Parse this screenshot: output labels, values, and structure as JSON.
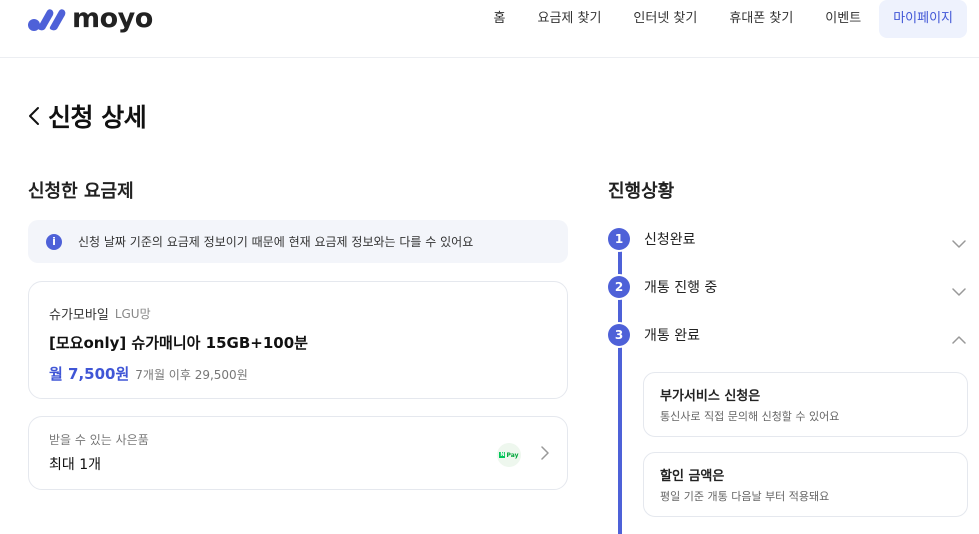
{
  "header": {
    "logo_text": "moyo",
    "nav": [
      {
        "label": "홈",
        "active": false
      },
      {
        "label": "요금제 찾기",
        "active": false
      },
      {
        "label": "인터넷 찾기",
        "active": false
      },
      {
        "label": "휴대폰 찾기",
        "active": false
      },
      {
        "label": "이벤트",
        "active": false
      },
      {
        "label": "마이페이지",
        "active": true
      }
    ]
  },
  "page": {
    "title": "신청 상세"
  },
  "plan_section": {
    "title": "신청한 요금제",
    "notice": "신청 날짜 기준의 요금제 정보이기 때문에 현재 요금제 정보와는 다를 수 있어요",
    "provider": "슈가모바일",
    "network": "LGU망",
    "plan_name": "[모요only] 슈가매니아 15GB+100분",
    "price": "월 7,500원",
    "price_after": "7개월 이후 29,500원"
  },
  "gift": {
    "label": "받을 수 있는 사은품",
    "value": "최대 1개",
    "badge": "Pay"
  },
  "progress": {
    "title": "진행상황",
    "steps": [
      {
        "num": "1",
        "label": "신청완료",
        "expanded": false
      },
      {
        "num": "2",
        "label": "개통 진행 중",
        "expanded": false
      },
      {
        "num": "3",
        "label": "개통 완료",
        "expanded": true
      }
    ],
    "details": [
      {
        "title": "부가서비스 신청은",
        "desc": "통신사로 직접 문의해 신청할 수 있어요"
      },
      {
        "title": "할인 금액은",
        "desc": "평일 기준 개통 다음날 부터 적용돼요"
      }
    ]
  },
  "colors": {
    "accent": "#4e61d8",
    "accent_text": "#4056d6",
    "notice_bg": "#f3f5fa",
    "nav_active_bg": "#eef2fd"
  }
}
